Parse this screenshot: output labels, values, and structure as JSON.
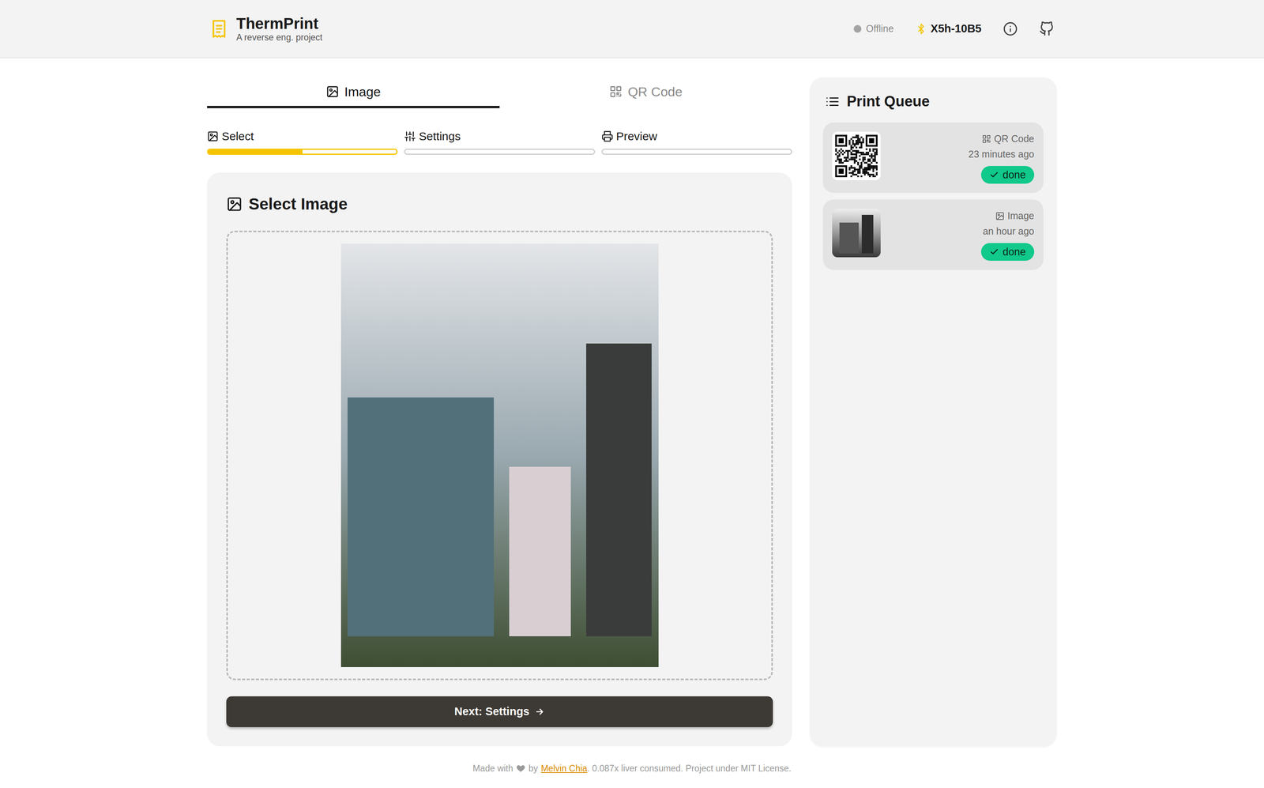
{
  "app": {
    "title": "ThermPrint",
    "subtitle": "A reverse eng. project"
  },
  "status": {
    "label": "Offline",
    "online": false
  },
  "device": {
    "name": "X5h-10B5"
  },
  "tabs": [
    {
      "label": "Image",
      "selected": true
    },
    {
      "label": "QR Code",
      "selected": false
    }
  ],
  "steps": [
    {
      "label": "Select",
      "selected": true,
      "level": 0.5
    },
    {
      "label": "Settings",
      "selected": false,
      "level": 0
    },
    {
      "label": "Preview",
      "selected": false,
      "level": 0
    }
  ],
  "panel": {
    "title": "Select Image",
    "button": "Next: Settings"
  },
  "queue": {
    "title": "Print Queue",
    "items": [
      {
        "kind": "qr",
        "type": "QR Code",
        "time": "23 minutes ago",
        "status": "done"
      },
      {
        "kind": "image",
        "type": "Image",
        "time": "an hour ago",
        "status": "done"
      }
    ]
  },
  "footer": {
    "before": "Made with",
    "by": "by",
    "author": "Melvin Chia",
    "after": ". 0.087x liver consumed. Project under MIT License."
  }
}
